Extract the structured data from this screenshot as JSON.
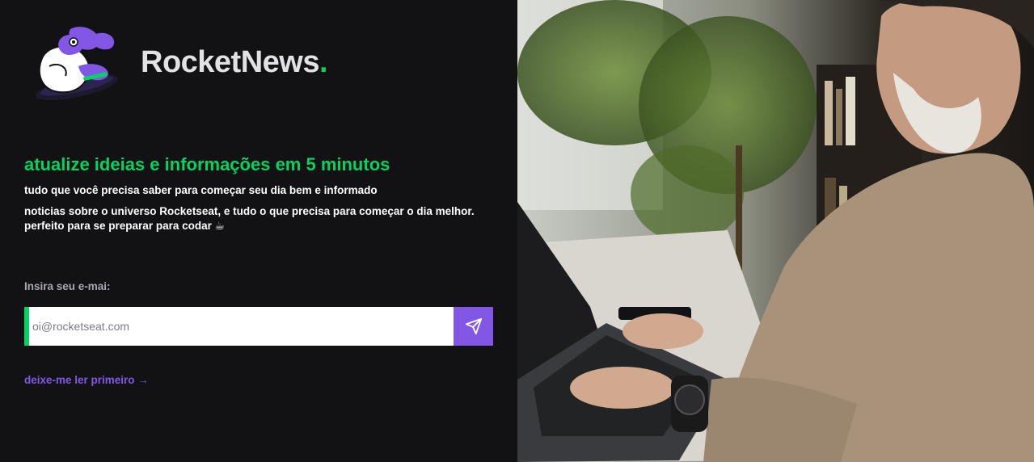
{
  "brand": {
    "name": "RocketNews",
    "dot": "."
  },
  "hero": {
    "headline": "atualize ideias e informações em 5 minutos",
    "subtitle": "tudo que você precisa saber para começar seu dia bem e informado",
    "description": "noticias sobre o universo Rocketseat, e tudo o que precisa para começar o dia melhor. perfeito para se preparar para codar ☕"
  },
  "form": {
    "label": "Insira seu e-mai:",
    "email_placeholder": "oi@rocketseat.com",
    "email_value": ""
  },
  "links": {
    "read_first": "deixe-me ler primeiro →"
  },
  "icons": {
    "send": "send-icon",
    "logo": "astronaut-logo-icon"
  },
  "colors": {
    "accent_green": "#04d361",
    "accent_purple": "#8257e5",
    "background": "#121214",
    "text_muted": "#a8a8b3"
  }
}
